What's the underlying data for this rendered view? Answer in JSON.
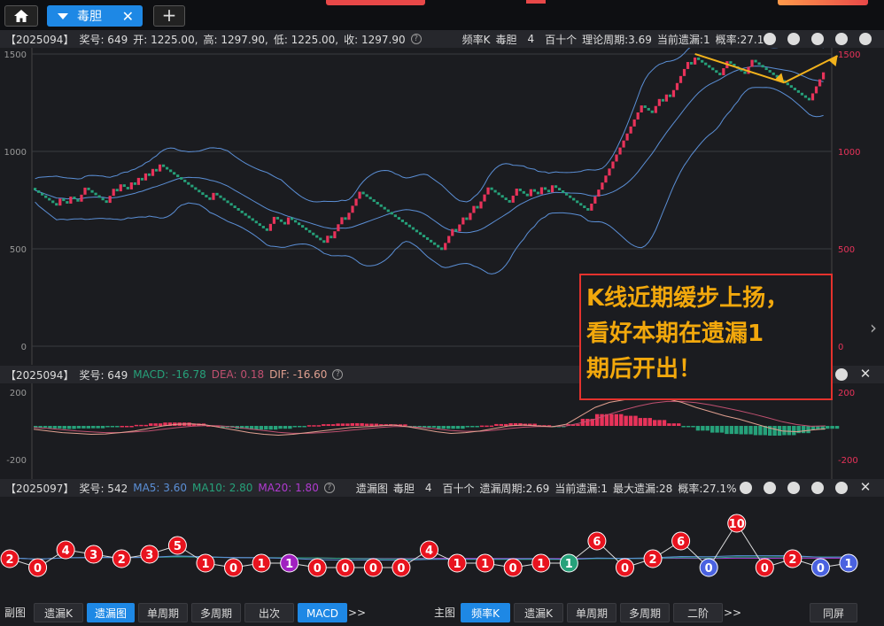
{
  "tabs": {
    "home_icon": "house-icon",
    "active_label": "毒胆",
    "close_glyph": "✕",
    "add_glyph": "+"
  },
  "main_panel": {
    "issue": "【2025094】",
    "prize": "奖号: 649",
    "open": "开: 1225.00,",
    "high": "高: 1297.90,",
    "low": "低: 1225.00,",
    "close": "收: 1297.90",
    "mode": "频率K",
    "target": "毒胆",
    "digit": "4",
    "pos": "百十个",
    "theory": "理论周期:3.69",
    "current": "当前遗漏:1",
    "prob": "概率:27.1%"
  },
  "macd_panel": {
    "issue": "【2025094】",
    "prize": "奖号: 649",
    "macd": "MACD: -16.78",
    "dea": "DEA: 0.18",
    "dif": "DIF: -16.60"
  },
  "miss_panel": {
    "issue": "【2025097】",
    "prize": "奖号: 542",
    "ma5": "MA5: 3.60",
    "ma10": "MA10: 2.80",
    "ma20": "MA20: 1.80",
    "mode": "遗漏图",
    "target": "毒胆",
    "digit": "4",
    "pos": "百十个",
    "period": "遗漏周期:2.69",
    "current": "当前遗漏:1",
    "max": "最大遗漏:28",
    "prob": "概率:27.1%"
  },
  "annotation": [
    "K线近期缓步上扬，",
    "看好本期在遗漏1",
    "期后开出！"
  ],
  "bottom_left": [
    "副图",
    "遗漏K",
    "遗漏图",
    "单周期",
    "多周期",
    "出次",
    "MACD",
    ">>"
  ],
  "bottom_right": [
    "主图",
    "频率K",
    "遗漏K",
    "单周期",
    "多周期",
    "二阶",
    ">>",
    "同屏"
  ],
  "colors": {
    "up": "#e8335a",
    "down": "#26a17a",
    "band": "#5b8fd6",
    "arrow": "#f2b21c",
    "dif": "#e0a090",
    "dea": "#c05070"
  },
  "chart_data": [
    {
      "type": "candlestick",
      "title": "频率K",
      "ylim": [
        0,
        1500
      ],
      "yticks": [
        "1500",
        "1000",
        "500",
        "0"
      ],
      "note": "red = 开出 step up (+ ~36), green = 遗漏 step down (- ~13)",
      "close": [
        800,
        787,
        774,
        761,
        748,
        735,
        722,
        758,
        745,
        732,
        768,
        755,
        742,
        778,
        814,
        801,
        788,
        775,
        762,
        749,
        736,
        772,
        808,
        795,
        831,
        818,
        805,
        841,
        828,
        864,
        851,
        887,
        874,
        910,
        897,
        933,
        920,
        907,
        894,
        881,
        868,
        855,
        842,
        829,
        816,
        803,
        790,
        777,
        764,
        751,
        787,
        774,
        761,
        748,
        735,
        722,
        709,
        696,
        683,
        670,
        657,
        644,
        631,
        618,
        605,
        592,
        628,
        664,
        651,
        638,
        625,
        661,
        648,
        635,
        622,
        609,
        596,
        583,
        570,
        557,
        544,
        531,
        567,
        554,
        590,
        626,
        662,
        649,
        685,
        721,
        757,
        793,
        780,
        767,
        754,
        741,
        728,
        715,
        702,
        689,
        676,
        663,
        650,
        637,
        624,
        611,
        598,
        585,
        572,
        559,
        546,
        533,
        520,
        507,
        494,
        530,
        566,
        602,
        589,
        625,
        661,
        648,
        684,
        720,
        707,
        743,
        779,
        815,
        802,
        789,
        776,
        763,
        750,
        737,
        773,
        809,
        796,
        783,
        770,
        806,
        793,
        780,
        816,
        803,
        790,
        826,
        813,
        800,
        787,
        774,
        761,
        748,
        735,
        722,
        709,
        696,
        732,
        768,
        804,
        840,
        876,
        912,
        948,
        984,
        1020,
        1056,
        1092,
        1128,
        1164,
        1200,
        1236,
        1223,
        1210,
        1197,
        1233,
        1269,
        1256,
        1292,
        1279,
        1315,
        1351,
        1387,
        1423,
        1459,
        1446,
        1482,
        1469,
        1456,
        1443,
        1430,
        1417,
        1404,
        1391,
        1427,
        1463,
        1450,
        1437,
        1424,
        1411,
        1398,
        1434,
        1470,
        1457,
        1444,
        1431,
        1418,
        1405,
        1392,
        1379,
        1366,
        1353,
        1340,
        1327,
        1314,
        1301,
        1288,
        1275,
        1262,
        1298,
        1334,
        1370,
        1406
      ]
    },
    {
      "type": "line",
      "title": "MACD",
      "ylim": [
        -200,
        200
      ],
      "yticks": [
        "200",
        "-200"
      ],
      "series": [
        {
          "name": "DIF",
          "values": [
            -20,
            -30,
            -40,
            -45,
            -50,
            -48,
            -40,
            -30,
            -15,
            0,
            10,
            12,
            5,
            -10,
            -25,
            -40,
            -50,
            -55,
            -50,
            -40,
            -30,
            -20,
            -10,
            -5,
            0,
            5,
            -5,
            -20,
            -35,
            -45,
            -40,
            -30,
            -15,
            0,
            5,
            0,
            -5,
            10,
            60,
            110,
            140,
            155,
            165,
            170,
            160,
            140,
            110,
            85,
            60,
            40,
            15,
            -10,
            -30,
            -35,
            -25,
            -16.6
          ]
        },
        {
          "name": "DEA",
          "values": [
            -10,
            -15,
            -22,
            -30,
            -36,
            -40,
            -40,
            -36,
            -30,
            -20,
            -10,
            -2,
            2,
            0,
            -8,
            -18,
            -28,
            -38,
            -44,
            -44,
            -40,
            -34,
            -26,
            -18,
            -10,
            -4,
            -4,
            -10,
            -18,
            -28,
            -32,
            -32,
            -26,
            -16,
            -8,
            -4,
            -4,
            0,
            18,
            40,
            70,
            95,
            118,
            135,
            145,
            145,
            138,
            125,
            108,
            90,
            70,
            48,
            25,
            8,
            -2,
            0.18
          ]
        }
      ]
    },
    {
      "type": "scatter",
      "title": "遗漏图",
      "values": [
        2,
        0,
        4,
        3,
        2,
        3,
        5,
        1,
        0,
        1,
        1,
        0,
        0,
        0,
        0,
        4,
        1,
        1,
        0,
        1,
        1,
        6,
        0,
        2,
        6,
        0,
        10,
        0,
        2,
        0,
        1
      ]
    }
  ]
}
